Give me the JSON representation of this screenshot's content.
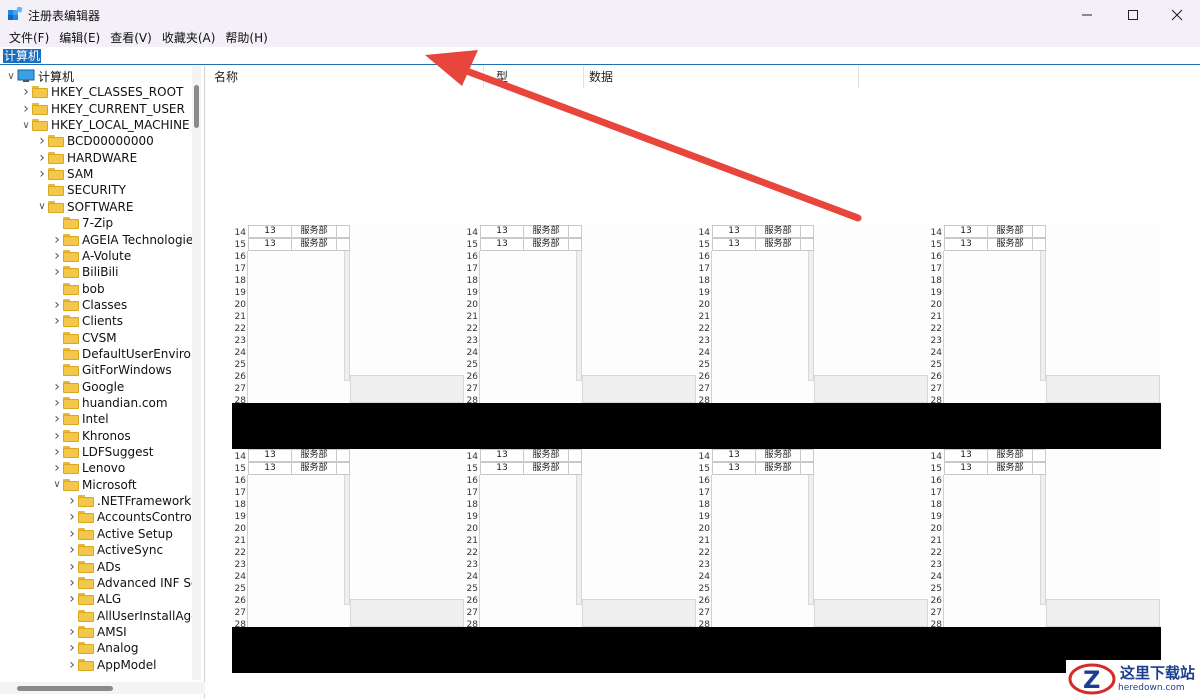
{
  "window": {
    "title": "注册表编辑器",
    "accent_color": "#1a6ec0"
  },
  "menu": {
    "items": [
      "文件(F)",
      "编辑(E)",
      "查看(V)",
      "收藏夹(A)",
      "帮助(H)"
    ]
  },
  "address": {
    "path": "计算机"
  },
  "tree": {
    "items": [
      {
        "label": "计算机",
        "level": 0,
        "state": "expanded",
        "icon": "computer-icon"
      },
      {
        "label": "HKEY_CLASSES_ROOT",
        "level": 1,
        "state": "collapsed",
        "icon": "folder-icon"
      },
      {
        "label": "HKEY_CURRENT_USER",
        "level": 1,
        "state": "collapsed",
        "icon": "folder-icon"
      },
      {
        "label": "HKEY_LOCAL_MACHINE",
        "level": 1,
        "state": "expanded",
        "icon": "folder-icon"
      },
      {
        "label": "BCD00000000",
        "level": 2,
        "state": "collapsed",
        "icon": "folder-icon"
      },
      {
        "label": "HARDWARE",
        "level": 2,
        "state": "collapsed",
        "icon": "folder-icon"
      },
      {
        "label": "SAM",
        "level": 2,
        "state": "collapsed",
        "icon": "folder-icon"
      },
      {
        "label": "SECURITY",
        "level": 2,
        "state": "none",
        "icon": "folder-icon"
      },
      {
        "label": "SOFTWARE",
        "level": 2,
        "state": "expanded",
        "icon": "folder-icon"
      },
      {
        "label": "7-Zip",
        "level": 3,
        "state": "none",
        "icon": "folder-icon"
      },
      {
        "label": "AGEIA Technologie",
        "level": 3,
        "state": "collapsed",
        "icon": "folder-icon"
      },
      {
        "label": "A-Volute",
        "level": 3,
        "state": "collapsed",
        "icon": "folder-icon"
      },
      {
        "label": "BiliBili",
        "level": 3,
        "state": "collapsed",
        "icon": "folder-icon"
      },
      {
        "label": "bob",
        "level": 3,
        "state": "none",
        "icon": "folder-icon"
      },
      {
        "label": "Classes",
        "level": 3,
        "state": "collapsed",
        "icon": "folder-icon"
      },
      {
        "label": "Clients",
        "level": 3,
        "state": "collapsed",
        "icon": "folder-icon"
      },
      {
        "label": "CVSM",
        "level": 3,
        "state": "none",
        "icon": "folder-icon"
      },
      {
        "label": "DefaultUserEnviron",
        "level": 3,
        "state": "none",
        "icon": "folder-icon"
      },
      {
        "label": "GitForWindows",
        "level": 3,
        "state": "none",
        "icon": "folder-icon"
      },
      {
        "label": "Google",
        "level": 3,
        "state": "collapsed",
        "icon": "folder-icon"
      },
      {
        "label": "huandian.com",
        "level": 3,
        "state": "collapsed",
        "icon": "folder-icon"
      },
      {
        "label": "Intel",
        "level": 3,
        "state": "collapsed",
        "icon": "folder-icon"
      },
      {
        "label": "Khronos",
        "level": 3,
        "state": "collapsed",
        "icon": "folder-icon"
      },
      {
        "label": "LDFSuggest",
        "level": 3,
        "state": "collapsed",
        "icon": "folder-icon"
      },
      {
        "label": "Lenovo",
        "level": 3,
        "state": "collapsed",
        "icon": "folder-icon"
      },
      {
        "label": "Microsoft",
        "level": 3,
        "state": "expanded",
        "icon": "folder-icon"
      },
      {
        "label": ".NETFramework",
        "level": 4,
        "state": "collapsed",
        "icon": "folder-icon"
      },
      {
        "label": "AccountsControl",
        "level": 4,
        "state": "collapsed",
        "icon": "folder-icon"
      },
      {
        "label": "Active Setup",
        "level": 4,
        "state": "collapsed",
        "icon": "folder-icon"
      },
      {
        "label": "ActiveSync",
        "level": 4,
        "state": "collapsed",
        "icon": "folder-icon"
      },
      {
        "label": "ADs",
        "level": 4,
        "state": "collapsed",
        "icon": "folder-icon"
      },
      {
        "label": "Advanced INF Se",
        "level": 4,
        "state": "collapsed",
        "icon": "folder-icon"
      },
      {
        "label": "ALG",
        "level": 4,
        "state": "collapsed",
        "icon": "folder-icon"
      },
      {
        "label": "AllUserInstallAge",
        "level": 4,
        "state": "none",
        "icon": "folder-icon"
      },
      {
        "label": "AMSI",
        "level": 4,
        "state": "collapsed",
        "icon": "folder-icon"
      },
      {
        "label": "Analog",
        "level": 4,
        "state": "collapsed",
        "icon": "folder-icon"
      },
      {
        "label": "AppModel",
        "level": 4,
        "state": "collapsed",
        "icon": "folder-icon"
      }
    ]
  },
  "list": {
    "columns": [
      "名称",
      "型",
      "数据"
    ]
  },
  "embedded_sheet": {
    "row_numbers": [
      "14",
      "15",
      "16",
      "17",
      "18",
      "19",
      "20",
      "21",
      "22",
      "23",
      "24",
      "25",
      "26",
      "27",
      "28"
    ],
    "cell_number": "13",
    "cell_dept": "服务部"
  },
  "watermark": {
    "title": "这里下载站",
    "url": "heredown.com"
  },
  "annotation": {
    "arrow_color": "#e8453c"
  }
}
